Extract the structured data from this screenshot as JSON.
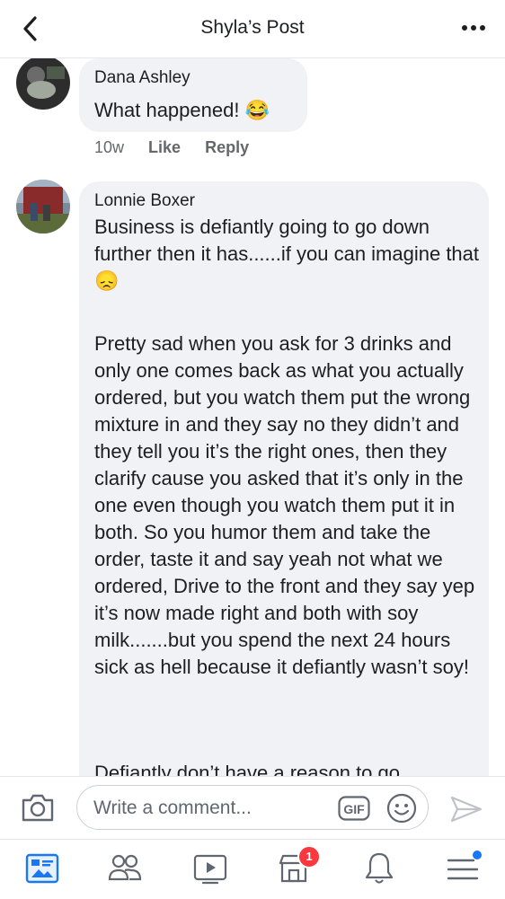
{
  "header": {
    "title": "Shyla’s Post",
    "back_icon": "chevron-left-icon",
    "more_icon": "more-horizontal-icon"
  },
  "comments": [
    {
      "author": "Dana Ashley",
      "text": "What happened! 😂",
      "time": "10w",
      "like_label": "Like",
      "reply_label": "Reply"
    },
    {
      "author": "Lonnie Boxer",
      "paragraphs": [
        "Business is defiantly going to go down further then it has......if you can imagine that 😞",
        "Pretty sad when you ask for 3 drinks and only one comes back as what you actually ordered, but you watch them put the wrong mixture in and they say no they didn’t and they tell you it’s the right ones, then they clarify cause you asked that it’s only in the one even though you watch them put it in both. So you humor them and take the order, taste it and say yeah not what we ordered, Drive to the front and they say yep it’s now made right and both with soy milk.......but you spend the next 24 hours sick as hell because it defiantly wasn’t soy!",
        "Defiantly don’t have a reason to go"
      ]
    }
  ],
  "composer": {
    "placeholder": "Write a comment...",
    "gif_label": "GIF",
    "camera_icon": "camera-icon",
    "emoji_icon": "smiley-icon",
    "send_icon": "send-icon"
  },
  "tabbar": {
    "items": [
      "news-feed-icon",
      "friends-icon",
      "watch-icon",
      "marketplace-icon",
      "notifications-icon",
      "menu-icon"
    ],
    "marketplace_badge": "1"
  },
  "colors": {
    "accent": "#1877f2",
    "badge": "#fa383e",
    "bubble": "#f0f2f5",
    "muted": "#65676b"
  }
}
